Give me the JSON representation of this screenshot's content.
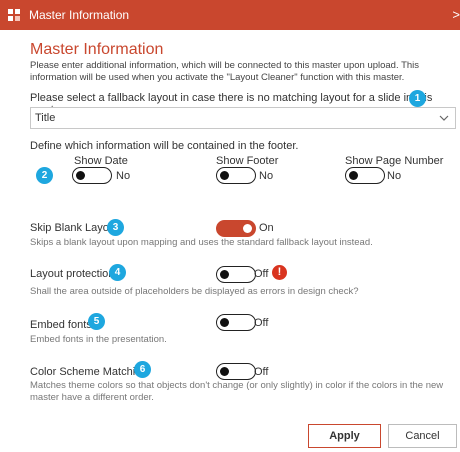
{
  "window": {
    "title": "Master Information",
    "close_glyph": ">",
    "brand_color": "#c9472e"
  },
  "main": {
    "heading": "Master Information",
    "intro": "Please enter additional information, which will be connected to this master upon upload. This information will be used when you activate the \"Layout Cleaner\" function with this master.",
    "fallback_prompt": "Please select a fallback layout in case there is no matching layout for a slide in this master:",
    "fallback_value": "Title",
    "footer_prompt": "Define which information will be contained in the footer."
  },
  "badges": [
    "1",
    "2",
    "3",
    "4",
    "5",
    "6"
  ],
  "footer_options": [
    {
      "label": "Show Date",
      "state": "No"
    },
    {
      "label": "Show Footer",
      "state": "No"
    },
    {
      "label": "Show Page Number",
      "state": "No"
    }
  ],
  "settings": [
    {
      "label": "Skip Blank Layout",
      "state": "On",
      "on": true,
      "desc": "Skips a blank layout upon mapping and uses the standard fallback layout instead."
    },
    {
      "label": "Layout protection",
      "state": "Off",
      "on": false,
      "desc": "Shall the area outside of placeholders be displayed as errors in design check?"
    },
    {
      "label": "Embed fonts",
      "state": "Off",
      "on": false,
      "desc": "Embed fonts in the presentation."
    },
    {
      "label": "Color Scheme Matching",
      "state": "Off",
      "on": false,
      "desc": "Matches theme colors so that objects don't change (or only slightly) in color if the colors in the new master have a different order."
    }
  ],
  "warning_glyph": "!",
  "buttons": {
    "apply": "Apply",
    "cancel": "Cancel"
  },
  "colors": {
    "badge": "#1ea7df",
    "toggle_on": "#c9472e",
    "warning": "#d9341f"
  },
  "icons": {
    "app": "master-app-icon",
    "chevron": "chevron-down-icon",
    "warning": "exclamation-icon"
  }
}
